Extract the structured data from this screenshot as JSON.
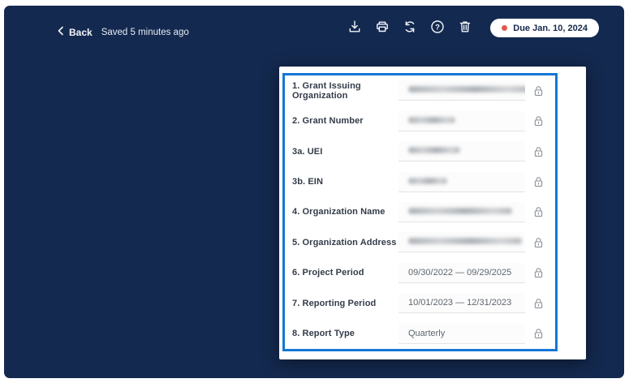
{
  "colors": {
    "canvas": "#14294f",
    "highlight_border": "#1577d4",
    "due_dot": "#e05a4e"
  },
  "toolbar": {
    "back_label": "Back",
    "saved_status": "Saved 5 minutes ago",
    "action_icons": [
      "download-icon",
      "print-icon",
      "sync-icon",
      "help-icon",
      "trash-icon"
    ],
    "due_badge": "Due Jan. 10, 2024"
  },
  "form": {
    "fields": [
      {
        "label": "1. Grant Issuing Organization",
        "value": "",
        "redacted": true,
        "blur_width": 150,
        "locked": true
      },
      {
        "label": "2. Grant Number",
        "value": "",
        "redacted": true,
        "blur_width": 58,
        "locked": true
      },
      {
        "label": "3a. UEI",
        "value": "",
        "redacted": true,
        "blur_width": 64,
        "locked": true
      },
      {
        "label": "3b. EIN",
        "value": "",
        "redacted": true,
        "blur_width": 48,
        "locked": true
      },
      {
        "label": "4. Organization Name",
        "value": "",
        "redacted": true,
        "blur_width": 128,
        "locked": true
      },
      {
        "label": "5. Organization Address",
        "value": "",
        "redacted": true,
        "blur_width": 140,
        "locked": true
      },
      {
        "label": "6. Project Period",
        "value": "09/30/2022 — 09/29/2025",
        "redacted": false,
        "locked": true
      },
      {
        "label": "7. Reporting Period",
        "value": "10/01/2023 — 12/31/2023",
        "redacted": false,
        "locked": true
      },
      {
        "label": "8. Report Type",
        "value": "Quarterly",
        "redacted": false,
        "locked": true
      }
    ]
  }
}
